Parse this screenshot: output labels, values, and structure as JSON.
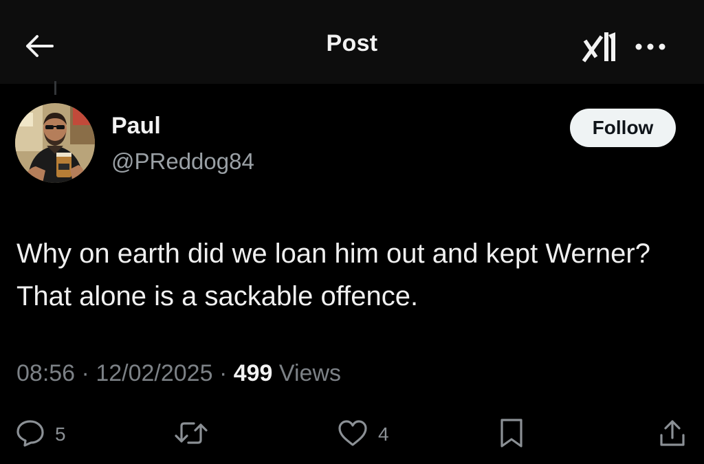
{
  "header": {
    "title": "Post",
    "back_icon": "arrow-left-icon",
    "grok_icon": "grok-icon",
    "more_icon": "more-horizontal-icon"
  },
  "author": {
    "display_name": "Paul",
    "handle": "@PReddog84",
    "follow_label": "Follow"
  },
  "post": {
    "text": "Why on earth did we loan him out and kept Werner? That alone is a sackable offence.",
    "time": "08:56",
    "separator": "·",
    "date": "12/02/2025",
    "views_count": "499",
    "views_label": "Views"
  },
  "actions": {
    "reply_count": "5",
    "like_count": "4",
    "icons": [
      "reply-icon",
      "repost-icon",
      "like-icon",
      "bookmark-icon",
      "share-icon"
    ]
  },
  "colors": {
    "background": "#000000",
    "header_bg": "#0d0d0d",
    "primary_text": "#f2f2f2",
    "secondary_text": "#7c8186",
    "follow_bg": "#eff3f4"
  }
}
